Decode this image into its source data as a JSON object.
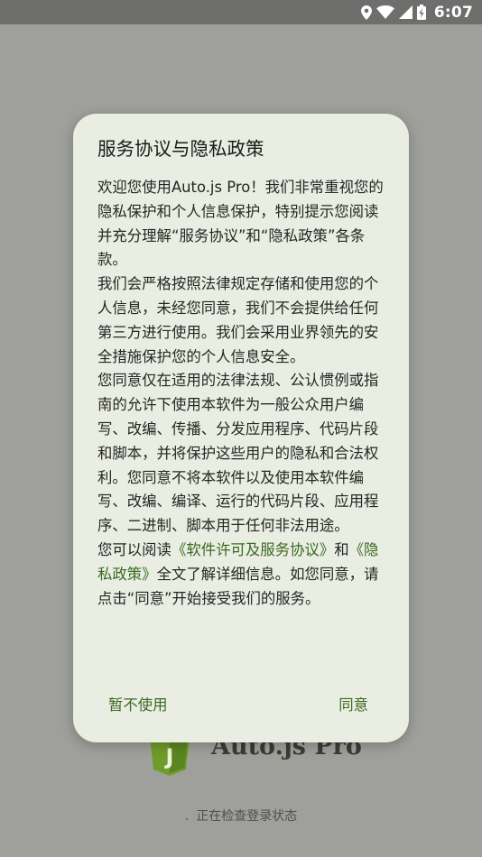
{
  "status_bar": {
    "time": "6:07",
    "icons": [
      "location-icon",
      "wifi-icon",
      "cell-signal-icon",
      "battery-charging-icon"
    ]
  },
  "splash": {
    "app_name": "Auto.js Pro",
    "logo_letter": "J",
    "loading_dot": ".",
    "loading_text": "正在检查登录状态"
  },
  "dialog": {
    "title": "服务协议与隐私政策",
    "p1": "欢迎您使用Auto.js Pro！我们非常重视您的隐私保护和个人信息保护，特别提示您阅读并充分理解“服务协议”和“隐私政策”各条款。",
    "p2": "我们会严格按照法律规定存储和使用您的个人信息，未经您同意，我们不会提供给任何第三方进行使用。我们会采用业界领先的安全措施保护您的个人信息安全。",
    "p3": "您同意仅在适用的法律法规、公认惯例或指南的允许下使用本软件为一般公众用户编写、改编、传播、分发应用程序、代码片段和脚本，并将保护这些用户的隐私和合法权利。您同意不将本软件以及使用本软件编写、改编、编译、运行的代码片段、应用程序、二进制、脚本用于任何非法用途。",
    "p4_prefix": "您可以阅读",
    "license_link": "《软件许可及服务协议》",
    "p4_and": "和",
    "privacy_link": "《隐私政策》",
    "p4_suffix": "全文了解详细信息。如您同意，请点击“同意”开始接受我们的服务。",
    "decline_label": "暂不使用",
    "agree_label": "同意"
  },
  "colors": {
    "accent": "#3a6a22",
    "dialog_bg": "#e9ede2",
    "scrim": "#9fa09b",
    "status_bar": "#6e6e6d"
  }
}
